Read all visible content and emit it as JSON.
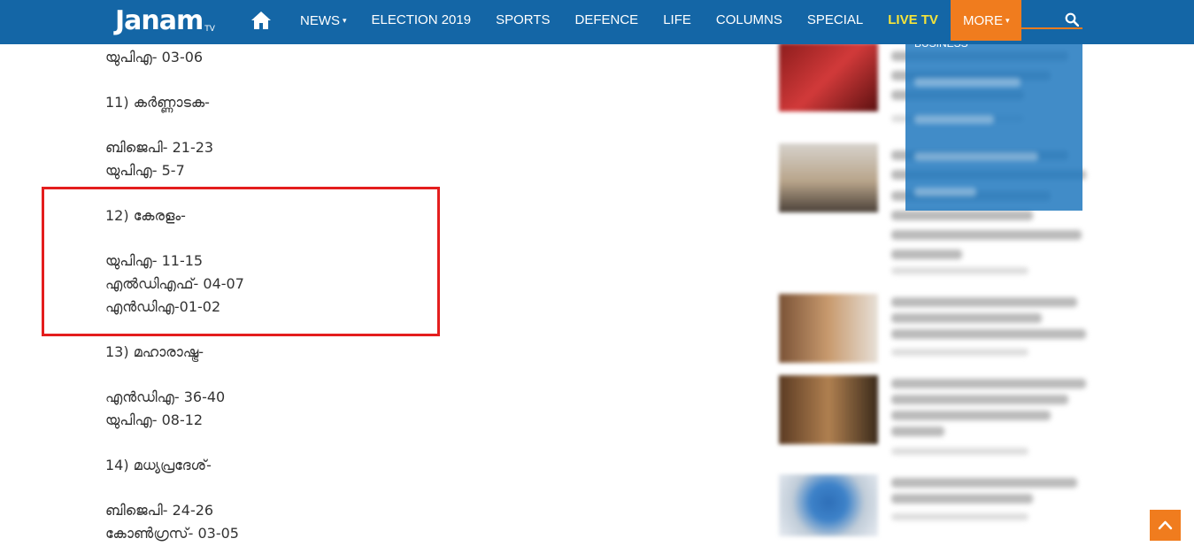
{
  "nav": {
    "logo_text": "Janam",
    "logo_sub": "TV",
    "items": [
      {
        "label": "NEWS",
        "caret": "▾"
      },
      {
        "label": "ELECTION 2019"
      },
      {
        "label": "SPORTS"
      },
      {
        "label": "DEFENCE"
      },
      {
        "label": "LIFE"
      },
      {
        "label": "COLUMNS"
      },
      {
        "label": "SPECIAL"
      },
      {
        "label": "LIVE TV"
      },
      {
        "label": "MORE",
        "caret": "▾"
      }
    ],
    "more_dropdown_first": "BUSINESS",
    "colors": {
      "bar": "#1466a6",
      "accent": "#f07c1e",
      "live": "#f5e43a"
    }
  },
  "article": {
    "lines": [
      "യുപിഎ- 03-06",
      "",
      "11) കർണ്ണാടക-",
      "",
      "ബിജെപി- 21-23",
      "യുപിഎ- 5-7",
      "",
      "12) കേരളം-",
      "",
      "യുപിഎ- 11-15",
      "എൽഡിഎഫ്- 04-07",
      "എൻഡിഎ-01-02",
      "",
      "13) മഹാരാഷ്ട്ര-",
      "",
      "എൻഡിഎ- 36-40",
      "യുപിഎ- 08-12",
      "",
      "14) മധ്യപ്രദേശ്-",
      "",
      "ബിജെപി- 24-26",
      "കോൺഗ്രസ്- 03-05"
    ]
  },
  "icons": {
    "home": "home-icon",
    "search": "search-icon",
    "scroll_top": "chevron-up-icon"
  }
}
